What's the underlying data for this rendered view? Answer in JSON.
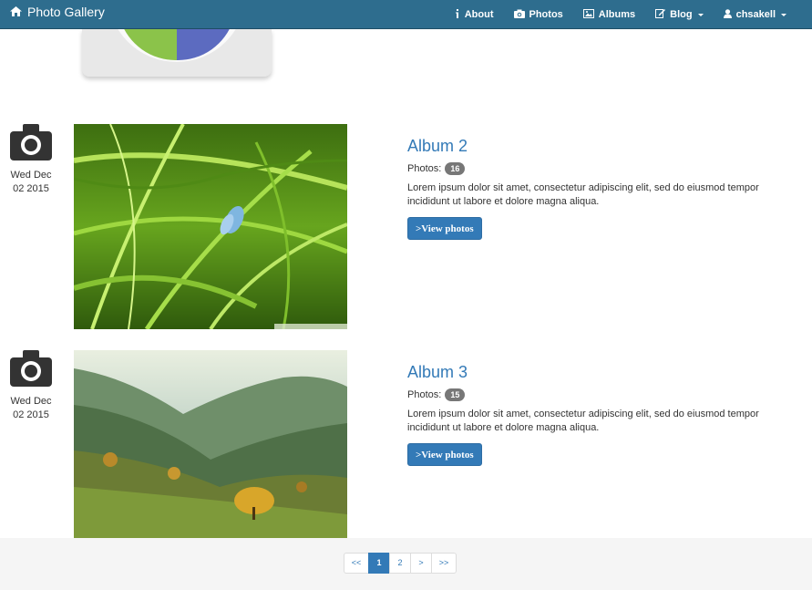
{
  "navbar": {
    "brand": "Photo Gallery",
    "items": [
      {
        "label": "About",
        "icon": "info-icon"
      },
      {
        "label": "Photos",
        "icon": "camera-icon"
      },
      {
        "label": "Albums",
        "icon": "picture-icon"
      },
      {
        "label": "Blog",
        "icon": "edit-icon",
        "dropdown": true
      },
      {
        "label": "chsakell",
        "icon": "user-icon",
        "dropdown": true
      }
    ]
  },
  "albums": [
    {
      "day": "Wed Dec",
      "date": "02 2015",
      "title": "Album 2",
      "photos_label": "Photos:",
      "photos_count": "16",
      "description": "Lorem ipsum dolor sit amet, consectetur adipiscing elit, sed do eiusmod tempor incididunt ut labore et dolore magna aliqua.",
      "button": ">View photos"
    },
    {
      "day": "Wed Dec",
      "date": "02 2015",
      "title": "Album 3",
      "photos_label": "Photos:",
      "photos_count": "15",
      "description": "Lorem ipsum dolor sit amet, consectetur adipiscing elit, sed do eiusmod tempor incididunt ut labore et dolore magna aliqua.",
      "button": ">View photos"
    }
  ],
  "pagination": [
    "<<",
    "1",
    "2",
    ">",
    ">>"
  ],
  "colors": {
    "navbar": "#2e6d8e",
    "primary": "#337ab7",
    "badge": "#777777"
  }
}
